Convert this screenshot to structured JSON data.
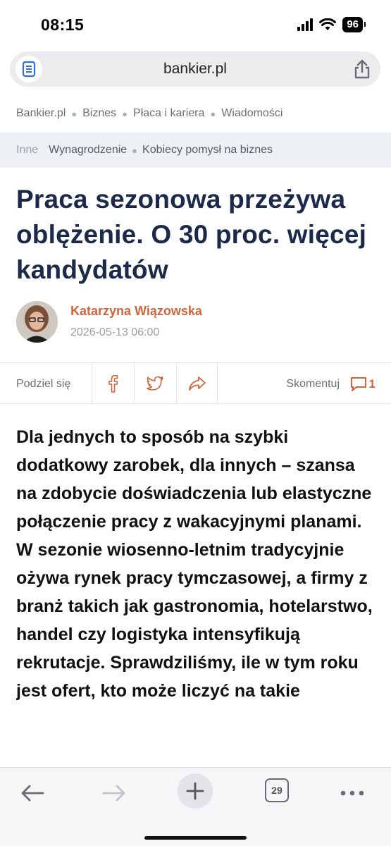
{
  "status_bar": {
    "time": "08:15",
    "battery": "96",
    "icons": [
      "cellular-signal-icon",
      "wifi-icon",
      "battery-icon"
    ]
  },
  "browser": {
    "url": "bankier.pl",
    "reader_icon": "reader-mode-icon",
    "share_icon": "share-icon"
  },
  "breadcrumb": {
    "items": [
      "Bankier.pl",
      "Biznes",
      "Płaca i kariera",
      "Wiadomości"
    ]
  },
  "tags": {
    "lead": "Inne",
    "items": [
      "Wynagrodzenie",
      "Kobiecy pomysł na biznes"
    ]
  },
  "article": {
    "title": "Praca sezonowa przeżywa oblężenie. O 30 proc. więcej kandydatów",
    "author": "Katarzyna Wiązowska",
    "date": "2026-05-13 06:00",
    "lead": "Dla jednych to sposób na szybki dodatkowy zarobek, dla innych – szansa na zdobycie doświadczenia lub elastyczne połączenie pracy z wakacyjnymi planami. W sezonie wiosenno-letnim tradycyjnie ożywa rynek pracy tymczasowej, a firmy z branż takich jak gastronomia, hotelarstwo, handel czy logistyka intensyfikują rekrutacje. Sprawdziliśmy, ile w tym roku jest ofert, kto może liczyć na takie"
  },
  "share": {
    "label": "Podziel się",
    "buttons": [
      "facebook-icon",
      "twitter-icon",
      "forward-share-icon"
    ],
    "comment_label": "Skomentuj",
    "comment_count": "1"
  },
  "toolbar": {
    "tab_count": "29",
    "buttons": [
      "back-arrow-icon",
      "forward-arrow-icon",
      "new-tab-plus-icon",
      "tabs-icon",
      "more-icon"
    ]
  },
  "colors": {
    "headline": "#1b2a4b",
    "accent": "#d0643b",
    "muted": "#6b6f78"
  }
}
